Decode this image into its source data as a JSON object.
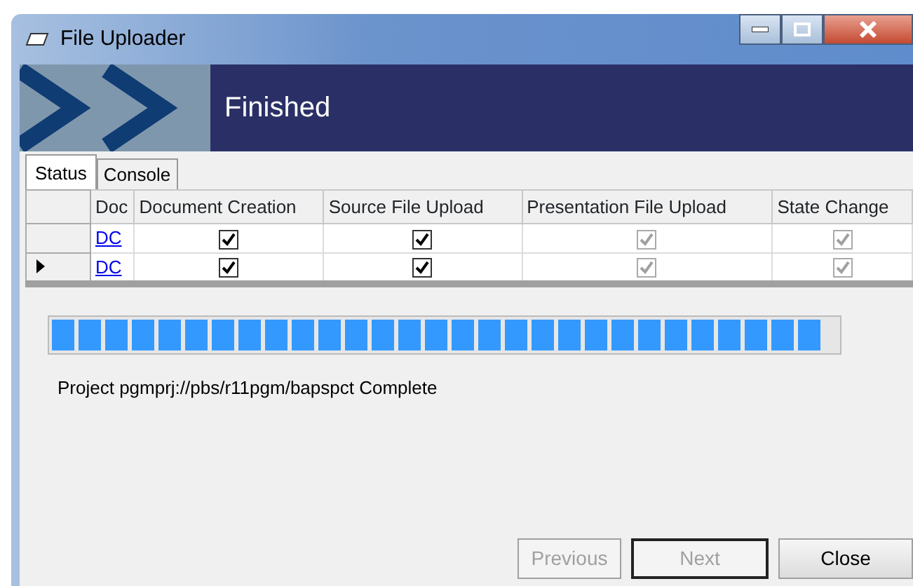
{
  "window": {
    "title": "File Uploader"
  },
  "banner": {
    "title": "Finished"
  },
  "tabs": [
    {
      "label": "Status",
      "selected": true
    },
    {
      "label": "Console",
      "selected": false
    }
  ],
  "table": {
    "columns": [
      "Doc",
      "Document Creation",
      "Source File Upload",
      "Presentation File Upload",
      "State Change"
    ],
    "rows": [
      {
        "selected": false,
        "doc": "DC",
        "cells": [
          {
            "checked": true,
            "disabled": false
          },
          {
            "checked": true,
            "disabled": false
          },
          {
            "checked": true,
            "disabled": true
          },
          {
            "checked": true,
            "disabled": true
          }
        ]
      },
      {
        "selected": true,
        "doc": "DC",
        "cells": [
          {
            "checked": true,
            "disabled": false
          },
          {
            "checked": true,
            "disabled": false
          },
          {
            "checked": true,
            "disabled": true
          },
          {
            "checked": true,
            "disabled": true
          }
        ]
      }
    ]
  },
  "progress": {
    "level": 1
  },
  "status_text": "Project pgmprj://pbs/r11pgm/bapspct Complete",
  "buttons": [
    {
      "label": "Previous",
      "disabled": true,
      "default": false
    },
    {
      "label": "Next",
      "disabled": true,
      "default": true
    },
    {
      "label": "Close",
      "disabled": false,
      "default": false
    }
  ]
}
